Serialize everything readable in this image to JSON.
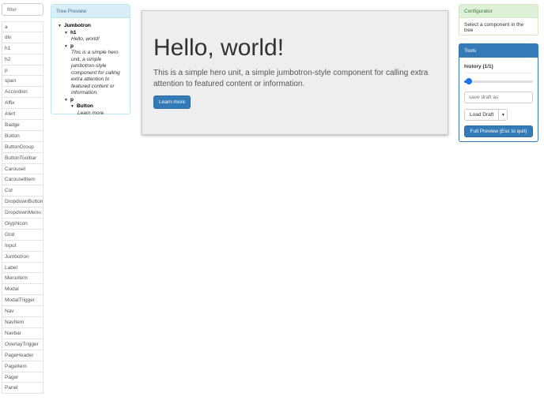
{
  "filter": {
    "placeholder": "filter"
  },
  "components": [
    "a",
    "div",
    "h1",
    "h2",
    "p",
    "span",
    "Accordion",
    "Affix",
    "Alert",
    "Badge",
    "Button",
    "ButtonGroup",
    "ButtonToolbar",
    "Carousel",
    "CarouselItem",
    "Col",
    "DropdownButton",
    "DropdownMenu",
    "Glyphicon",
    "Grid",
    "Input",
    "Jumbotron",
    "Label",
    "MenuItem",
    "Modal",
    "ModalTrigger",
    "Nav",
    "NavItem",
    "Navbar",
    "OverlayTrigger",
    "PageHeader",
    "PageItem",
    "Pager",
    "Panel"
  ],
  "tree": {
    "title": "Tree Preview",
    "root": "Jumbotron",
    "h1": "h1",
    "h1_text": "Hello, world!",
    "p1": "p",
    "p1_text": "This is a simple hero unit, a simple jumbotron-style component for calling extra attention to featured content or information.",
    "p2": "p",
    "button": "Button",
    "button_text": "Learn more"
  },
  "jumbotron": {
    "heading": "Hello, world!",
    "text": "This is a simple hero unit, a simple jumbotron-style component for calling extra attention to featured content or information.",
    "button": "Learn more"
  },
  "configurator": {
    "title": "Configurator",
    "message": "Select a component in the tree"
  },
  "tools": {
    "title": "Tools",
    "history": "history (1/1)",
    "history_value": 1,
    "history_max": 1,
    "draft_placeholder": "save draft as",
    "load": "Load Draft",
    "full_preview": "Full Preview (Esc to quit)"
  }
}
